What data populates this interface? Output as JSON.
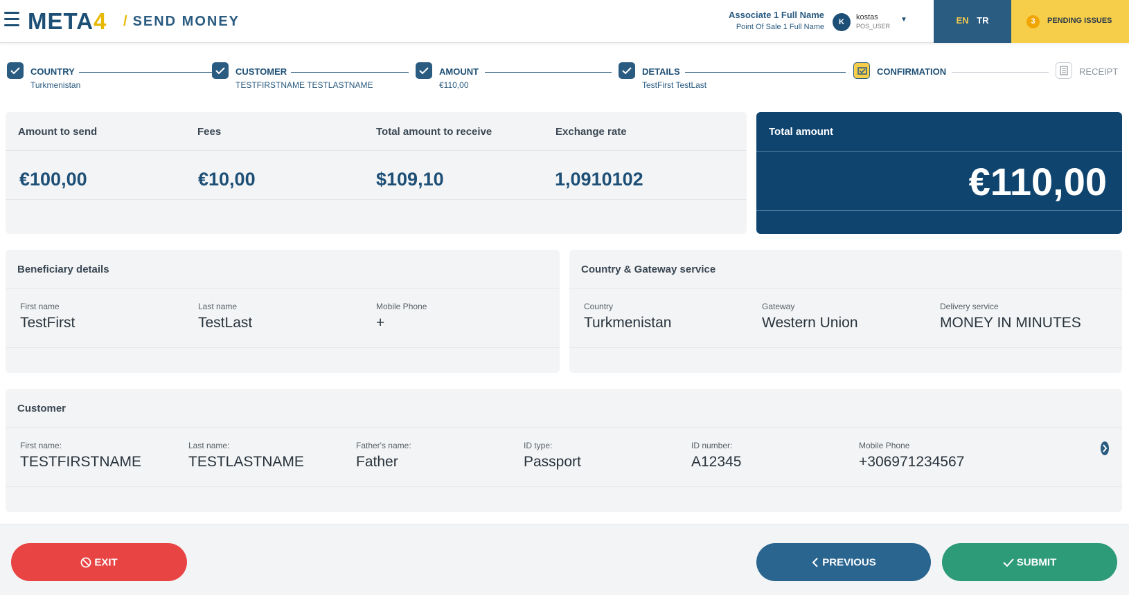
{
  "header": {
    "logo_main": "META",
    "logo_digit": "4",
    "page_title": "SEND MONEY",
    "associate_name": "Associate 1 Full Name",
    "point_of_sale": "Point Of Sale 1 Full Name",
    "avatar_initial": "K",
    "user_name": "kostas",
    "user_role": "POS_USER",
    "lang_en": "EN",
    "lang_tr": "TR",
    "pending_count": "3",
    "pending_label": "PENDING ISSUES"
  },
  "steps": [
    {
      "label": "COUNTRY",
      "value": "Turkmenistan",
      "state": "done"
    },
    {
      "label": "CUSTOMER",
      "value": "TESTFIRSTNAME TESTLASTNAME",
      "state": "done"
    },
    {
      "label": "AMOUNT",
      "value": "€110,00",
      "state": "done"
    },
    {
      "label": "DETAILS",
      "value": "TestFirst TestLast",
      "state": "done"
    },
    {
      "label": "CONFIRMATION",
      "value": "",
      "state": "current"
    },
    {
      "label": "RECEIPT",
      "value": "",
      "state": "todo"
    }
  ],
  "summary": {
    "amount_to_send_label": "Amount to send",
    "amount_to_send": "€100,00",
    "fees_label": "Fees",
    "fees": "€10,00",
    "total_receive_label": "Total amount to receive",
    "total_receive": "$109,10",
    "exchange_rate_label": "Exchange rate",
    "exchange_rate": "1,0910102",
    "total_amount_label": "Total amount",
    "total_amount": "€110,00"
  },
  "beneficiary": {
    "title": "Beneficiary details",
    "first_name_label": "First name",
    "first_name": "TestFirst",
    "last_name_label": "Last name",
    "last_name": "TestLast",
    "mobile_label": "Mobile Phone",
    "mobile": "+"
  },
  "gateway": {
    "title": "Country & Gateway service",
    "country_label": "Country",
    "country": "Turkmenistan",
    "gateway_label": "Gateway",
    "gateway": "Western Union",
    "delivery_label": "Delivery service",
    "delivery": "MONEY IN MINUTES"
  },
  "customer": {
    "title": "Customer",
    "first_name_label": "First name:",
    "first_name": "TESTFIRSTNAME",
    "last_name_label": "Last name:",
    "last_name": "TESTLASTNAME",
    "father_label": "Father's name:",
    "father": "Father",
    "id_type_label": "ID type:",
    "id_type": "Passport",
    "id_number_label": "ID number:",
    "id_number": "A12345",
    "mobile_label": "Mobile Phone",
    "mobile": "+306971234567"
  },
  "footer": {
    "exit_label": "EXIT",
    "previous_label": "PREVIOUS",
    "submit_label": "SUBMIT"
  },
  "colors": {
    "primary": "#1d4f76",
    "accent_yellow": "#f6ce4a",
    "exit_red": "#e84444",
    "submit_green": "#2e9b78",
    "total_bg": "#0f446f"
  }
}
